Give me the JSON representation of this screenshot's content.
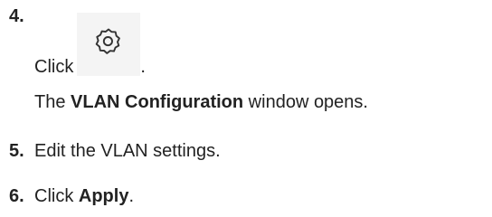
{
  "steps": [
    {
      "number": "4.",
      "click_prefix": "Click",
      "click_suffix": ".",
      "icon": "gear-icon",
      "result_prefix": "The ",
      "result_bold": "VLAN Configuration",
      "result_suffix": " window opens."
    },
    {
      "number": "5.",
      "text": "Edit the VLAN settings."
    },
    {
      "number": "6.",
      "prefix": "Click ",
      "bold": "Apply",
      "suffix": "."
    }
  ]
}
